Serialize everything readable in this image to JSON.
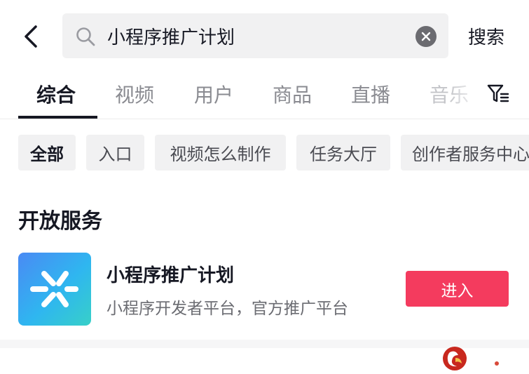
{
  "search": {
    "value": "小程序推广计划",
    "submit_label": "搜索",
    "icons": {
      "back": "back-arrow-icon",
      "search": "search-icon",
      "clear": "clear-icon"
    }
  },
  "tabs": {
    "items": [
      {
        "label": "综合",
        "active": true
      },
      {
        "label": "视频",
        "active": false
      },
      {
        "label": "用户",
        "active": false
      },
      {
        "label": "商品",
        "active": false
      },
      {
        "label": "直播",
        "active": false
      },
      {
        "label": "音乐",
        "active": false
      }
    ],
    "filter_icon": "filter-icon"
  },
  "chips": {
    "items": [
      {
        "label": "全部",
        "active": true
      },
      {
        "label": "入口",
        "active": false
      },
      {
        "label": "视频怎么制作",
        "active": false
      },
      {
        "label": "任务大厅",
        "active": false
      },
      {
        "label": "创作者服务中心",
        "active": false
      }
    ]
  },
  "section": {
    "title": "开放服务",
    "app": {
      "title": "小程序推广计划",
      "description": "小程序开发者平台，官方推广平台",
      "action_label": "进入",
      "icon": "mini-program-logo-icon"
    }
  },
  "colors": {
    "accent": "#f43b5e",
    "text_primary": "#161823",
    "text_secondary": "#8a8b91",
    "chip_bg": "#f1f1f2"
  }
}
